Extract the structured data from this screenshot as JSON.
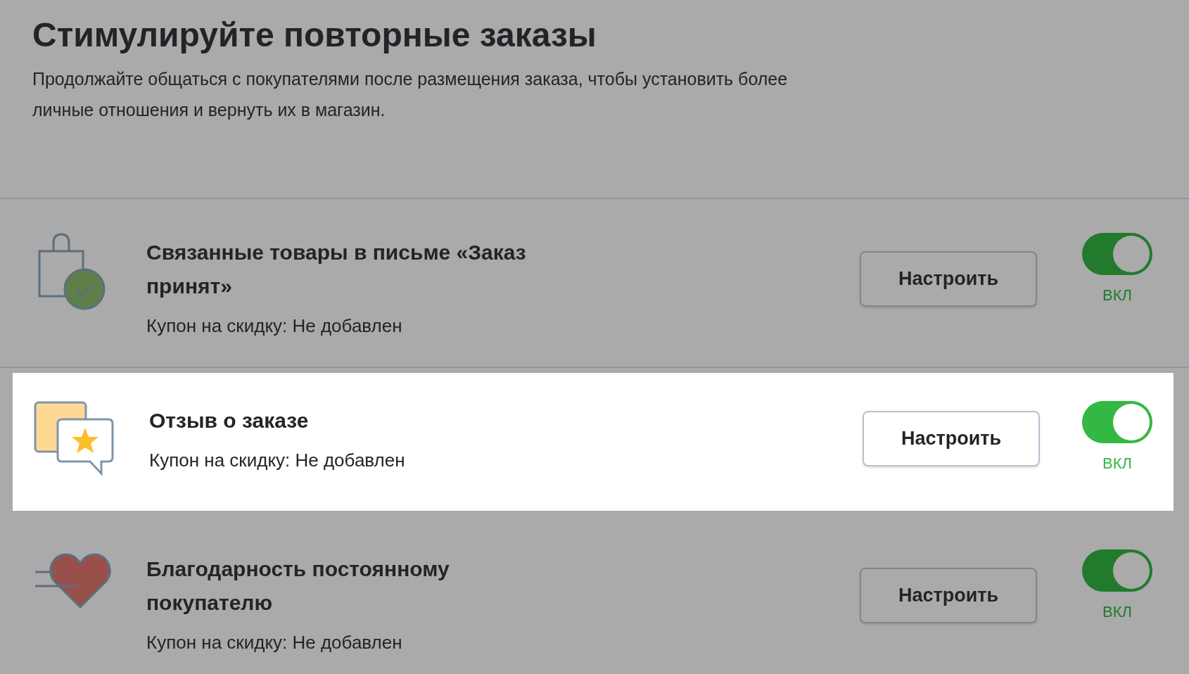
{
  "header": {
    "title": "Стимулируйте повторные заказы",
    "description": "Продолжайте общаться с покупателями после размещения заказа, чтобы установить более личные отношения и вернуть их в магазин."
  },
  "items": [
    {
      "kind": "bag",
      "title": "Связанные товары в письме «Заказ принят»",
      "coupon": "Купон на скидку: Не добавлен",
      "button": "Настроить",
      "on": true,
      "status": "ВКЛ",
      "selected": false
    },
    {
      "kind": "review",
      "title": "Отзыв о заказе",
      "coupon": "Купон на скидку: Не добавлен",
      "button": "Настроить",
      "on": true,
      "status": "ВКЛ",
      "selected": true
    },
    {
      "kind": "heart",
      "title": "Благодарность постоянному покупателю",
      "coupon": "Купон на скидку: Не добавлен",
      "button": "Настроить",
      "on": true,
      "status": "ВКЛ",
      "selected": false
    }
  ]
}
